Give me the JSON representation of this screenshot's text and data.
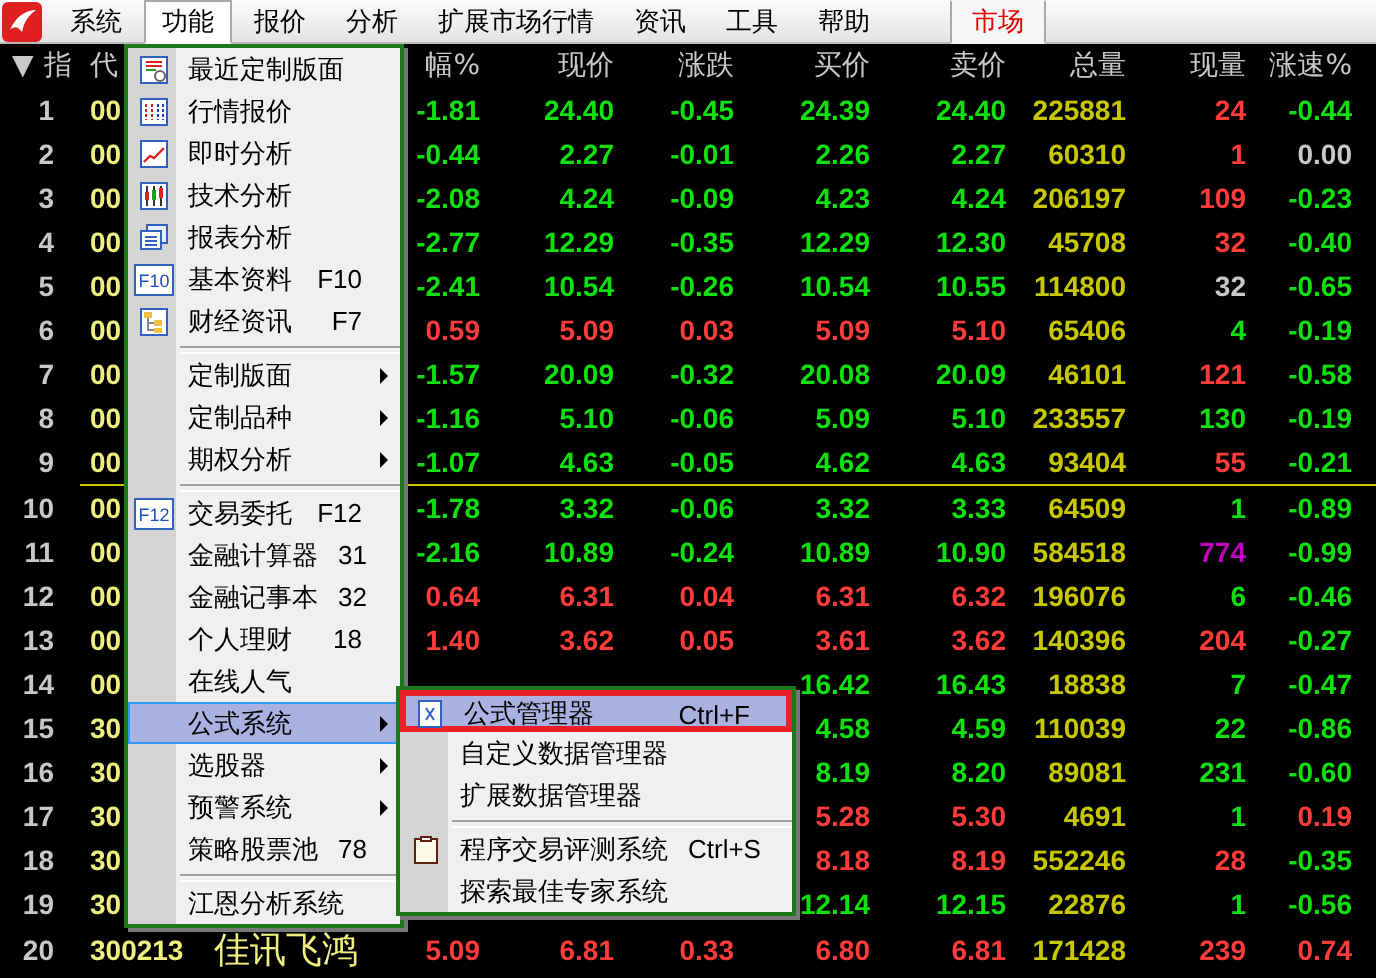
{
  "menu_bar": {
    "items": [
      {
        "label": "系统",
        "kind": "menu",
        "selected": false
      },
      {
        "label": "功能",
        "kind": "menu",
        "selected": true
      },
      {
        "label": "报价",
        "kind": "menu",
        "selected": false
      },
      {
        "label": "分析",
        "kind": "menu",
        "selected": false
      },
      {
        "label": "扩展市场行情",
        "kind": "menu",
        "selected": false
      },
      {
        "label": "资讯",
        "kind": "menu",
        "selected": false
      },
      {
        "label": "工具",
        "kind": "menu",
        "selected": false
      },
      {
        "label": "帮助",
        "kind": "menu",
        "selected": false
      },
      {
        "label": "市场",
        "kind": "tab",
        "selected": true
      }
    ]
  },
  "table": {
    "sort_marker": "▼",
    "columns": [
      "指",
      "代",
      null,
      "幅%",
      "现价",
      "涨跌",
      "买价",
      "卖价",
      "总量",
      "现量",
      "涨速%"
    ],
    "row_groups": [
      {
        "rows": [
          {
            "index": "1",
            "code": "00",
            "cells": [
              {
                "text": "-1.81",
                "color": "#10e010"
              },
              {
                "text": "24.40",
                "color": "#10e010"
              },
              {
                "text": "-0.45",
                "color": "#10e010"
              },
              {
                "text": "24.39",
                "color": "#10e010"
              },
              {
                "text": "24.40",
                "color": "#10e010"
              },
              {
                "text": "225881",
                "color": "#c8c800"
              },
              {
                "text": "24",
                "color": "#ff3c3c"
              },
              {
                "text": "-0.44",
                "color": "#10e010"
              }
            ]
          },
          {
            "index": "2",
            "code": "00",
            "cells": [
              {
                "text": "-0.44",
                "color": "#10e010"
              },
              {
                "text": "2.27",
                "color": "#10e010"
              },
              {
                "text": "-0.01",
                "color": "#10e010"
              },
              {
                "text": "2.26",
                "color": "#10e010"
              },
              {
                "text": "2.27",
                "color": "#10e010"
              },
              {
                "text": "60310",
                "color": "#c8c800"
              },
              {
                "text": "1",
                "color": "#ff3c3c"
              },
              {
                "text": "0.00",
                "color": "#c8c8c8"
              }
            ]
          },
          {
            "index": "3",
            "code": "00",
            "cells": [
              {
                "text": "-2.08",
                "color": "#10e010"
              },
              {
                "text": "4.24",
                "color": "#10e010"
              },
              {
                "text": "-0.09",
                "color": "#10e010"
              },
              {
                "text": "4.23",
                "color": "#10e010"
              },
              {
                "text": "4.24",
                "color": "#10e010"
              },
              {
                "text": "206197",
                "color": "#c8c800"
              },
              {
                "text": "109",
                "color": "#ff3c3c"
              },
              {
                "text": "-0.23",
                "color": "#10e010"
              }
            ]
          },
          {
            "index": "4",
            "code": "00",
            "cells": [
              {
                "text": "-2.77",
                "color": "#10e010"
              },
              {
                "text": "12.29",
                "color": "#10e010"
              },
              {
                "text": "-0.35",
                "color": "#10e010"
              },
              {
                "text": "12.29",
                "color": "#10e010"
              },
              {
                "text": "12.30",
                "color": "#10e010"
              },
              {
                "text": "45708",
                "color": "#c8c800"
              },
              {
                "text": "32",
                "color": "#ff3c3c"
              },
              {
                "text": "-0.40",
                "color": "#10e010"
              }
            ]
          },
          {
            "index": "5",
            "code": "00",
            "cells": [
              {
                "text": "-2.41",
                "color": "#10e010"
              },
              {
                "text": "10.54",
                "color": "#10e010"
              },
              {
                "text": "-0.26",
                "color": "#10e010"
              },
              {
                "text": "10.54",
                "color": "#10e010"
              },
              {
                "text": "10.55",
                "color": "#10e010"
              },
              {
                "text": "114800",
                "color": "#c8c800"
              },
              {
                "text": "32",
                "color": "#c8c8c8"
              },
              {
                "text": "-0.65",
                "color": "#10e010"
              }
            ]
          },
          {
            "index": "6",
            "code": "00",
            "cells": [
              {
                "text": "0.59",
                "color": "#ff3c3c"
              },
              {
                "text": "5.09",
                "color": "#ff3c3c"
              },
              {
                "text": "0.03",
                "color": "#ff3c3c"
              },
              {
                "text": "5.09",
                "color": "#ff3c3c"
              },
              {
                "text": "5.10",
                "color": "#ff3c3c"
              },
              {
                "text": "65406",
                "color": "#c8c800"
              },
              {
                "text": "4",
                "color": "#10e010"
              },
              {
                "text": "-0.19",
                "color": "#10e010"
              }
            ]
          },
          {
            "index": "7",
            "code": "00",
            "cells": [
              {
                "text": "-1.57",
                "color": "#10e010"
              },
              {
                "text": "20.09",
                "color": "#10e010"
              },
              {
                "text": "-0.32",
                "color": "#10e010"
              },
              {
                "text": "20.08",
                "color": "#10e010"
              },
              {
                "text": "20.09",
                "color": "#10e010"
              },
              {
                "text": "46101",
                "color": "#c8c800"
              },
              {
                "text": "121",
                "color": "#ff3c3c"
              },
              {
                "text": "-0.58",
                "color": "#10e010"
              }
            ]
          },
          {
            "index": "8",
            "code": "00",
            "cells": [
              {
                "text": "-1.16",
                "color": "#10e010"
              },
              {
                "text": "5.10",
                "color": "#10e010"
              },
              {
                "text": "-0.06",
                "color": "#10e010"
              },
              {
                "text": "5.09",
                "color": "#10e010"
              },
              {
                "text": "5.10",
                "color": "#10e010"
              },
              {
                "text": "233557",
                "color": "#c8c800"
              },
              {
                "text": "130",
                "color": "#10e010"
              },
              {
                "text": "-0.19",
                "color": "#10e010"
              }
            ]
          },
          {
            "index": "9",
            "code": "00",
            "cells": [
              {
                "text": "-1.07",
                "color": "#10e010"
              },
              {
                "text": "4.63",
                "color": "#10e010"
              },
              {
                "text": "-0.05",
                "color": "#10e010"
              },
              {
                "text": "4.62",
                "color": "#10e010"
              },
              {
                "text": "4.63",
                "color": "#10e010"
              },
              {
                "text": "93404",
                "color": "#c8c800"
              },
              {
                "text": "55",
                "color": "#ff3c3c"
              },
              {
                "text": "-0.21",
                "color": "#10e010"
              }
            ]
          }
        ]
      },
      {
        "rows": [
          {
            "index": "10",
            "code": "00",
            "cells": [
              {
                "text": "-1.78",
                "color": "#10e010"
              },
              {
                "text": "3.32",
                "color": "#10e010"
              },
              {
                "text": "-0.06",
                "color": "#10e010"
              },
              {
                "text": "3.32",
                "color": "#10e010"
              },
              {
                "text": "3.33",
                "color": "#10e010"
              },
              {
                "text": "64509",
                "color": "#c8c800"
              },
              {
                "text": "1",
                "color": "#10e010"
              },
              {
                "text": "-0.89",
                "color": "#10e010"
              }
            ]
          },
          {
            "index": "11",
            "code": "00",
            "cells": [
              {
                "text": "-2.16",
                "color": "#10e010"
              },
              {
                "text": "10.89",
                "color": "#10e010"
              },
              {
                "text": "-0.24",
                "color": "#10e010"
              },
              {
                "text": "10.89",
                "color": "#10e010"
              },
              {
                "text": "10.90",
                "color": "#10e010"
              },
              {
                "text": "584518",
                "color": "#c8c800"
              },
              {
                "text": "774",
                "color": "#c000c0"
              },
              {
                "text": "-0.99",
                "color": "#10e010"
              }
            ]
          },
          {
            "index": "12",
            "code": "00",
            "cells": [
              {
                "text": "0.64",
                "color": "#ff3c3c"
              },
              {
                "text": "6.31",
                "color": "#ff3c3c"
              },
              {
                "text": "0.04",
                "color": "#ff3c3c"
              },
              {
                "text": "6.31",
                "color": "#ff3c3c"
              },
              {
                "text": "6.32",
                "color": "#ff3c3c"
              },
              {
                "text": "196076",
                "color": "#c8c800"
              },
              {
                "text": "6",
                "color": "#10e010"
              },
              {
                "text": "-0.46",
                "color": "#10e010"
              }
            ]
          },
          {
            "index": "13",
            "code": "00",
            "cells": [
              {
                "text": "1.40",
                "color": "#ff3c3c"
              },
              {
                "text": "3.62",
                "color": "#ff3c3c"
              },
              {
                "text": "0.05",
                "color": "#ff3c3c"
              },
              {
                "text": "3.61",
                "color": "#ff3c3c"
              },
              {
                "text": "3.62",
                "color": "#ff3c3c"
              },
              {
                "text": "140396",
                "color": "#c8c800"
              },
              {
                "text": "204",
                "color": "#ff3c3c"
              },
              {
                "text": "-0.27",
                "color": "#10e010"
              }
            ]
          },
          {
            "index": "14",
            "code": "00",
            "cells": [
              null,
              null,
              null,
              {
                "text": "16.42",
                "color": "#10e010"
              },
              {
                "text": "16.43",
                "color": "#10e010"
              },
              {
                "text": "18838",
                "color": "#c8c800"
              },
              {
                "text": "7",
                "color": "#10e010"
              },
              {
                "text": "-0.47",
                "color": "#10e010"
              }
            ]
          },
          {
            "index": "15",
            "code": "30",
            "cells": [
              null,
              null,
              null,
              {
                "text": "4.58",
                "color": "#10e010"
              },
              {
                "text": "4.59",
                "color": "#10e010"
              },
              {
                "text": "110039",
                "color": "#c8c800"
              },
              {
                "text": "22",
                "color": "#10e010"
              },
              {
                "text": "-0.86",
                "color": "#10e010"
              }
            ]
          },
          {
            "index": "16",
            "code": "30",
            "cells": [
              null,
              null,
              null,
              {
                "text": "8.19",
                "color": "#10e010"
              },
              {
                "text": "8.20",
                "color": "#10e010"
              },
              {
                "text": "89081",
                "color": "#c8c800"
              },
              {
                "text": "231",
                "color": "#10e010"
              },
              {
                "text": "-0.60",
                "color": "#10e010"
              }
            ]
          },
          {
            "index": "17",
            "code": "30",
            "cells": [
              null,
              null,
              null,
              {
                "text": "5.28",
                "color": "#ff3c3c"
              },
              {
                "text": "5.30",
                "color": "#ff3c3c"
              },
              {
                "text": "4691",
                "color": "#c8c800"
              },
              {
                "text": "1",
                "color": "#10e010"
              },
              {
                "text": "0.19",
                "color": "#ff3c3c"
              }
            ]
          },
          {
            "index": "18",
            "code": "30",
            "cells": [
              null,
              null,
              null,
              {
                "text": "8.18",
                "color": "#ff3c3c"
              },
              {
                "text": "8.19",
                "color": "#ff3c3c"
              },
              {
                "text": "552246",
                "color": "#c8c800"
              },
              {
                "text": "28",
                "color": "#ff3c3c"
              },
              {
                "text": "-0.35",
                "color": "#10e010"
              }
            ]
          },
          {
            "index": "19",
            "code": "30",
            "cells": [
              null,
              null,
              null,
              {
                "text": "12.14",
                "color": "#10e010"
              },
              {
                "text": "12.15",
                "color": "#10e010"
              },
              {
                "text": "22876",
                "color": "#c8c800"
              },
              {
                "text": "1",
                "color": "#10e010"
              },
              {
                "text": "-0.56",
                "color": "#10e010"
              }
            ]
          },
          {
            "index": "20",
            "code": "300213",
            "name": "佳讯飞鸿",
            "cells": [
              {
                "text": "5.09",
                "color": "#ff3c3c"
              },
              {
                "text": "6.81",
                "color": "#ff3c3c"
              },
              {
                "text": "0.33",
                "color": "#ff3c3c"
              },
              {
                "text": "6.80",
                "color": "#ff3c3c"
              },
              {
                "text": "6.81",
                "color": "#ff3c3c"
              },
              {
                "text": "171428",
                "color": "#c8c800"
              },
              {
                "text": "239",
                "color": "#ff3c3c"
              },
              {
                "text": "0.74",
                "color": "#ff3c3c"
              }
            ]
          }
        ]
      }
    ]
  },
  "function_menu": {
    "items": [
      {
        "kind": "item",
        "label": "最近定制版面",
        "selected": false
      },
      {
        "kind": "item",
        "label": "行情报价",
        "selected": false
      },
      {
        "kind": "item",
        "label": "即时分析",
        "selected": false
      },
      {
        "kind": "item",
        "label": "技术分析",
        "selected": false
      },
      {
        "kind": "item",
        "label": "报表分析",
        "selected": false
      },
      {
        "kind": "item",
        "label": "基本资料",
        "shortcut": "F10",
        "icon_text": "F10",
        "selected": false
      },
      {
        "kind": "item",
        "label": "财经资讯",
        "shortcut": "F7",
        "selected": false
      },
      {
        "kind": "separator"
      },
      {
        "kind": "submenu",
        "label": "定制版面",
        "selected": false
      },
      {
        "kind": "submenu",
        "label": "定制品种",
        "selected": false
      },
      {
        "kind": "submenu",
        "label": "期权分析",
        "selected": false
      },
      {
        "kind": "separator"
      },
      {
        "kind": "item",
        "label": "交易委托",
        "shortcut": "F12",
        "icon_text": "F12",
        "selected": false
      },
      {
        "kind": "item",
        "label": "金融计算器",
        "shortcut": "31",
        "selected": false
      },
      {
        "kind": "item",
        "label": "金融记事本",
        "shortcut": "32",
        "selected": false
      },
      {
        "kind": "item",
        "label": "个人理财",
        "shortcut": "18",
        "selected": false
      },
      {
        "kind": "item",
        "label": "在线人气",
        "selected": false
      },
      {
        "kind": "submenu",
        "label": "公式系统",
        "selected": true
      },
      {
        "kind": "submenu",
        "label": "选股器",
        "selected": false
      },
      {
        "kind": "submenu",
        "label": "预警系统",
        "selected": false
      },
      {
        "kind": "item",
        "label": "策略股票池",
        "shortcut": "78",
        "selected": false
      },
      {
        "kind": "separator"
      },
      {
        "kind": "item",
        "label": "江恩分析系统",
        "selected": false
      }
    ]
  },
  "formula_submenu": {
    "items": [
      {
        "kind": "item",
        "label": "公式管理器",
        "shortcut": "Ctrl+F",
        "selected": true
      },
      {
        "kind": "item",
        "label": "自定义数据管理器",
        "selected": false
      },
      {
        "kind": "item",
        "label": "扩展数据管理器",
        "selected": false
      },
      {
        "kind": "separator"
      },
      {
        "kind": "item",
        "label": "程序交易评测系统",
        "shortcut": "Ctrl+S",
        "selected": false
      },
      {
        "kind": "item",
        "label": "探索最佳专家系统",
        "selected": false
      }
    ]
  }
}
